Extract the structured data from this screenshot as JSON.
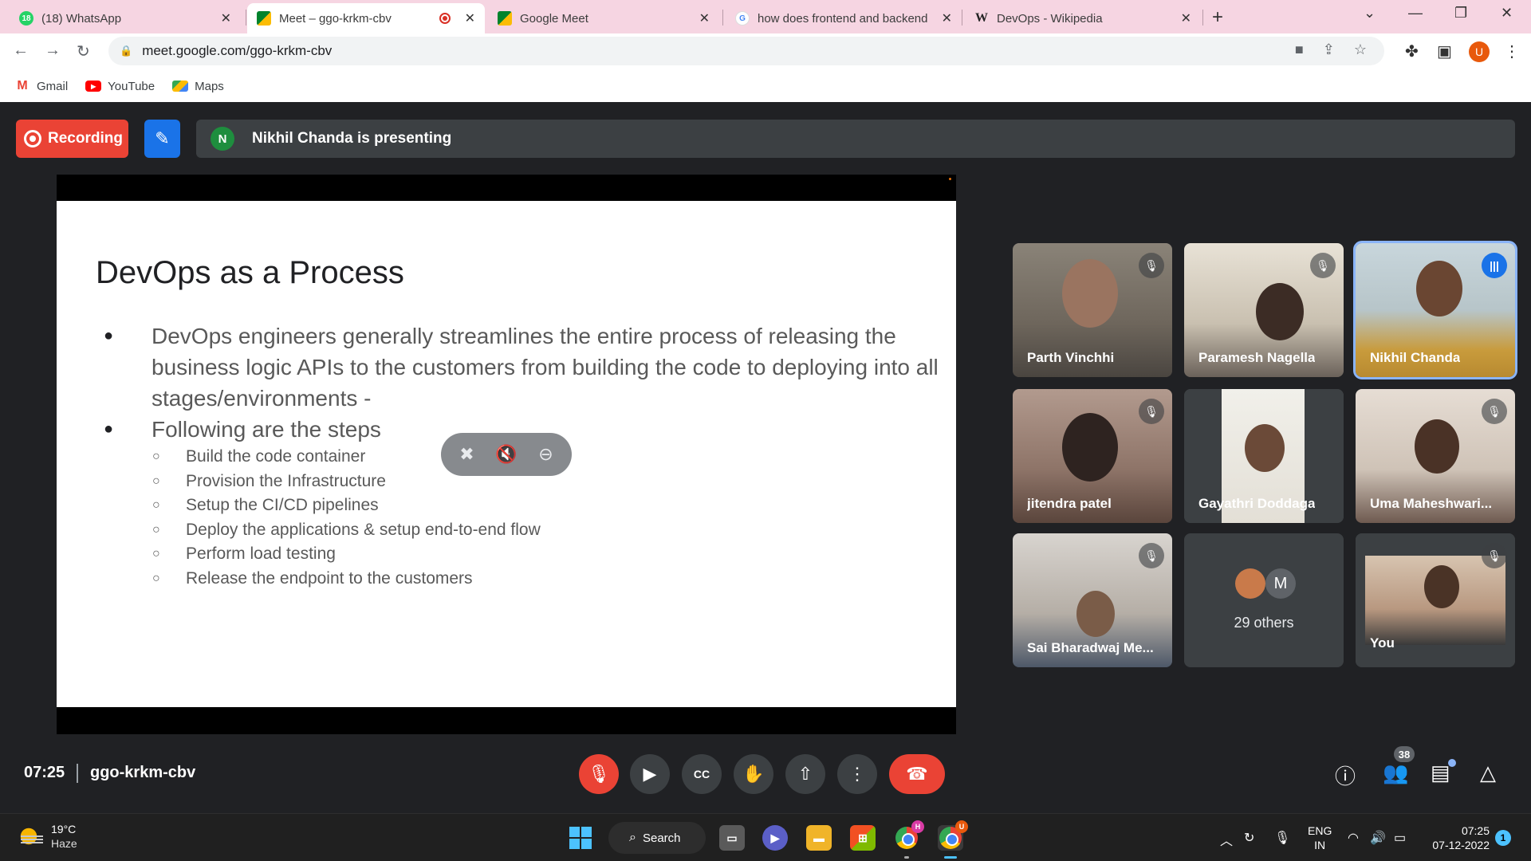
{
  "browser": {
    "tabs": [
      {
        "title": "(18) WhatsApp",
        "badge": "18"
      },
      {
        "title": "Meet – ggo-krkm-cbv"
      },
      {
        "title": "Google Meet"
      },
      {
        "title": "how does frontend and backend"
      },
      {
        "title": "DevOps - Wikipedia"
      }
    ],
    "url": "meet.google.com/ggo-krkm-cbv",
    "profile_initial": "U",
    "bookmarks": [
      {
        "label": "Gmail"
      },
      {
        "label": "YouTube"
      },
      {
        "label": "Maps"
      }
    ]
  },
  "meet": {
    "recording_label": "Recording",
    "presenter_initial": "N",
    "presenting_text": "Nikhil Chanda is presenting",
    "clock": "07:25",
    "meeting_code": "ggo-krkm-cbv",
    "participant_count": "38",
    "participants": [
      {
        "name": "Parth Vinchhi",
        "muted": true
      },
      {
        "name": "Paramesh Nagella",
        "muted": true
      },
      {
        "name": "Nikhil Chanda",
        "muted": false,
        "speaking": true
      },
      {
        "name": "jitendra patel",
        "muted": true
      },
      {
        "name": "Gayathri Doddaga",
        "muted": false
      },
      {
        "name": "Uma Maheshwari...",
        "muted": true
      },
      {
        "name": "Sai Bharadwaj Me...",
        "muted": true
      },
      {
        "others_initial": "M",
        "others_label": "29 others"
      },
      {
        "name": "You",
        "muted": true
      }
    ]
  },
  "slide": {
    "title": "DevOps as a Process",
    "bullets": [
      "DevOps engineers generally streamlines the entire process of releasing the business logic APIs to the customers from building the code to deploying into all stages/environments -",
      "Following are the steps"
    ],
    "steps": [
      "Build the code container",
      "Provision the Infrastructure",
      "Setup the CI/CD pipelines",
      "Deploy the applications & setup end-to-end flow",
      "Perform load testing",
      "Release the endpoint to the customers"
    ]
  },
  "taskbar": {
    "temperature": "19°C",
    "weather": "Haze",
    "search_label": "Search",
    "chrome_profile_1": "H",
    "chrome_profile_2": "U",
    "language": "ENG",
    "region": "IN",
    "time": "07:25",
    "date": "07-12-2022",
    "notification_count": "1"
  },
  "colors": {
    "recording": "#ea4335",
    "accent": "#1a73e8",
    "meet_background": "#202124",
    "tab_strip": "#f6d5e2"
  }
}
